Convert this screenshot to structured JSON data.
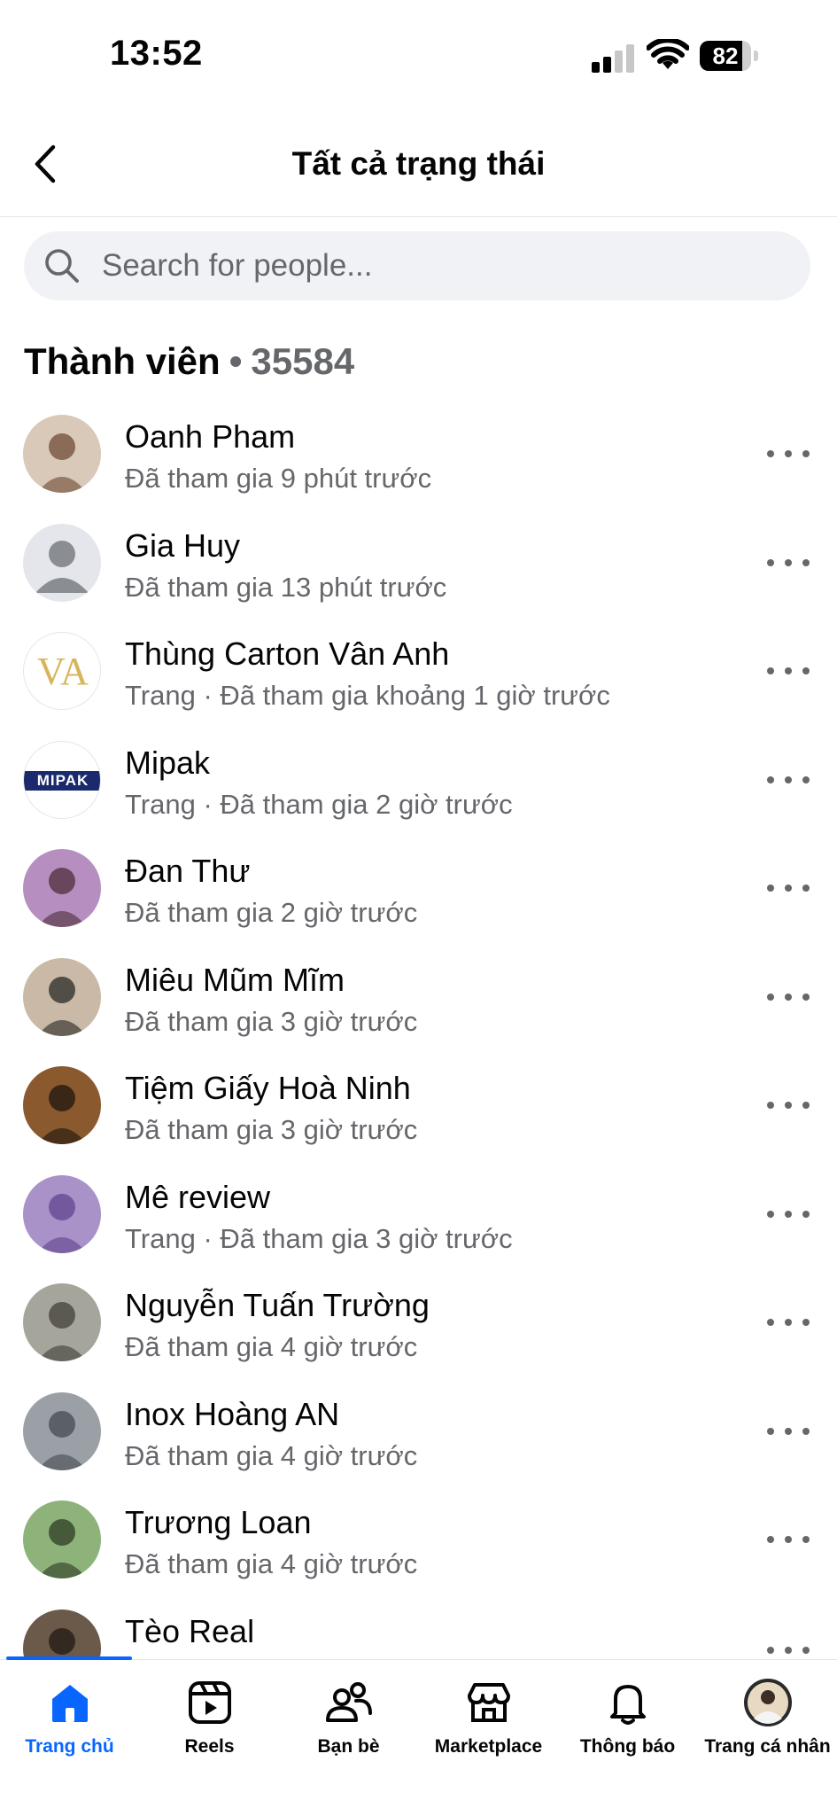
{
  "status_bar": {
    "time": "13:52",
    "battery": "82",
    "battery_level": 0.82,
    "icons": [
      "cellular-signal-icon",
      "wifi-icon",
      "battery-icon"
    ]
  },
  "header": {
    "title": "Tất cả trạng thái",
    "back_icon": "chevron-left-icon"
  },
  "search": {
    "placeholder": "Search for people...",
    "value": ""
  },
  "section": {
    "title": "Thành viên",
    "separator": "•",
    "count": "35584"
  },
  "members": [
    {
      "name": "Oanh Pham",
      "subtitle": "Đã tham gia 9 phút trước",
      "avatar": {
        "type": "photo",
        "bg": "#d9c9b8",
        "fg": "#7a5a45"
      }
    },
    {
      "name": "Gia Huy",
      "subtitle": "Đã tham gia 13 phút trước",
      "avatar": {
        "type": "default",
        "bg": "#e4e6eb",
        "fg": "#8a8d91"
      }
    },
    {
      "name": "Thùng Carton Vân Anh",
      "subtitle": "Trang · Đã tham gia khoảng 1 giờ trước",
      "avatar": {
        "type": "logo",
        "text": "VA",
        "bg": "#ffffff",
        "fg": "#d8b45a"
      }
    },
    {
      "name": "Mipak",
      "subtitle": "Trang · Đã tham gia 2 giờ trước",
      "avatar": {
        "type": "logo",
        "text": "MIPAK",
        "bg": "#ffffff",
        "fg": "#1a2a6c"
      }
    },
    {
      "name": "Đan Thư",
      "subtitle": "Đã tham gia 2 giờ trước",
      "avatar": {
        "type": "photo",
        "bg": "#b68fc0",
        "fg": "#5b3a4a"
      }
    },
    {
      "name": "Miêu Mũm Mĩm",
      "subtitle": "Đã tham gia 3 giờ trước",
      "avatar": {
        "type": "photo",
        "bg": "#c9b9a6",
        "fg": "#3c3a36"
      }
    },
    {
      "name": "Tiệm Giấy Hoà Ninh",
      "subtitle": "Đã tham gia 3 giờ trước",
      "avatar": {
        "type": "photo",
        "bg": "#8a5a2e",
        "fg": "#2b1d12"
      }
    },
    {
      "name": "Mê review",
      "subtitle": "Trang · Đã tham gia 3 giờ trước",
      "avatar": {
        "type": "photo",
        "bg": "#a892c8",
        "fg": "#6a4e96"
      }
    },
    {
      "name": "Nguyễn Tuấn Trường",
      "subtitle": "Đã tham gia 4 giờ trước",
      "avatar": {
        "type": "photo",
        "bg": "#a6a59c",
        "fg": "#4d4b45"
      }
    },
    {
      "name": "Inox Hoàng AN",
      "subtitle": "Đã tham gia 4 giờ trước",
      "avatar": {
        "type": "photo",
        "bg": "#9aa0a6",
        "fg": "#50555b"
      }
    },
    {
      "name": "Trương Loan",
      "subtitle": "Đã tham gia 4 giờ trước",
      "avatar": {
        "type": "photo",
        "bg": "#8db27a",
        "fg": "#3a4a2f"
      }
    },
    {
      "name": "Tèo Real",
      "subtitle": "",
      "avatar": {
        "type": "photo",
        "bg": "#6b5a4a",
        "fg": "#2a211a"
      }
    }
  ],
  "more_icon": "more-horizontal-icon",
  "tab_bar": {
    "active_index": 0,
    "accent": "#0866ff",
    "tabs": [
      {
        "label": "Trang chủ",
        "icon": "home-icon"
      },
      {
        "label": "Reels",
        "icon": "reels-icon"
      },
      {
        "label": "Bạn bè",
        "icon": "friends-icon"
      },
      {
        "label": "Marketplace",
        "icon": "marketplace-icon"
      },
      {
        "label": "Thông báo",
        "icon": "bell-icon"
      },
      {
        "label": "Trang cá nhân",
        "icon": "profile-avatar-icon"
      }
    ]
  }
}
